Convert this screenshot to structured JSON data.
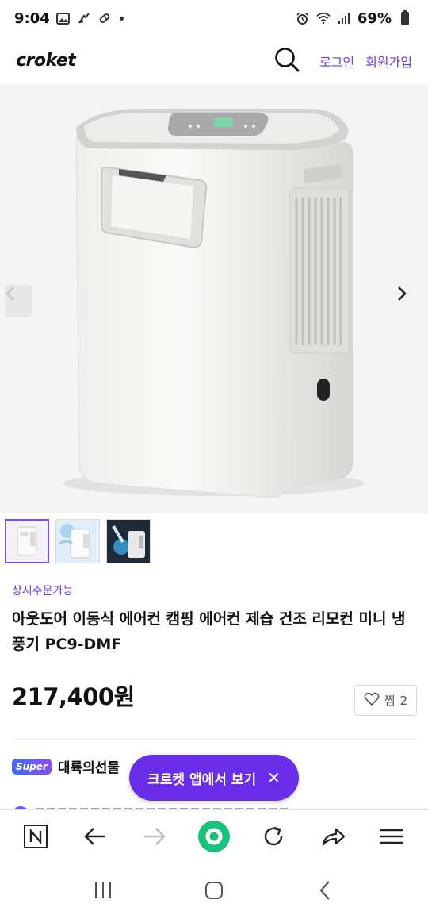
{
  "status_bar": {
    "time": "9:04",
    "battery": "69%"
  },
  "header": {
    "logo": "croket",
    "login": "로그인",
    "signup": "회원가입"
  },
  "product": {
    "availability": "상시주문가능",
    "title": "아웃도어 이동식 에어컨 캠핑 에어컨 제습 건조 리모컨 미니 냉풍기 PC9-DMF",
    "price": "217,400원",
    "wish_label": "찜",
    "wish_count": "2",
    "thumbnails": [
      "thumbnail-1",
      "thumbnail-2",
      "thumbnail-3"
    ]
  },
  "seller": {
    "badge": "Super",
    "name": "대륙의선물"
  },
  "app_cta": {
    "label": "크로켓 앱에서 보기",
    "close": "✕"
  },
  "icons": {
    "search": "search-icon",
    "prev": "chevron-left-icon",
    "next": "chevron-right-icon",
    "heart": "heart-icon"
  },
  "colors": {
    "accent": "#6a2ee8",
    "link": "#6b3fd6",
    "browser_home": "#19c37d"
  }
}
